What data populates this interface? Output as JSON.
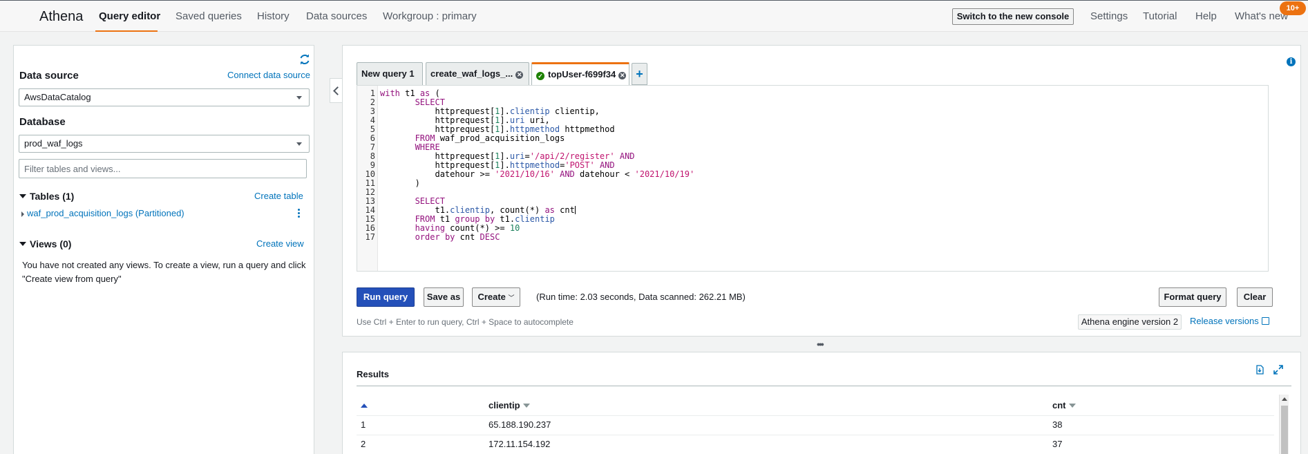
{
  "nav": {
    "brand": "Athena",
    "items": [
      {
        "label": "Query editor",
        "active": true
      },
      {
        "label": "Saved queries"
      },
      {
        "label": "History"
      },
      {
        "label": "Data sources"
      },
      {
        "label": "Workgroup : primary"
      }
    ],
    "switch_console": "Switch to the new console",
    "right_items": [
      "Settings",
      "Tutorial",
      "Help",
      "What's new"
    ],
    "badge": "10+"
  },
  "sidebar": {
    "data_source_label": "Data source",
    "connect_link": "Connect data source",
    "data_source_value": "AwsDataCatalog",
    "database_label": "Database",
    "database_value": "prod_waf_logs",
    "filter_placeholder": "Filter tables and views...",
    "tables_heading": "Tables (1)",
    "create_table": "Create table",
    "table_item": "waf_prod_acquisition_logs (Partitioned)",
    "views_heading": "Views (0)",
    "create_view": "Create view",
    "views_message": "You have not created any views. To create a view, run a query and click \"Create view from query\""
  },
  "editor": {
    "tabs": [
      "New query 1",
      "create_waf_logs_...",
      "topUser-f699f34"
    ],
    "add_tab": "+",
    "line_numbers": [
      "1",
      "2",
      "3",
      "4",
      "5",
      "6",
      "7",
      "8",
      "9",
      "10",
      "11",
      "12",
      "13",
      "14",
      "15",
      "16",
      "17"
    ],
    "run_query": "Run query",
    "save_as": "Save as",
    "create": "Create",
    "run_info": "(Run time: 2.03 seconds, Data scanned: 262.21 MB)",
    "format_query": "Format query",
    "clear": "Clear",
    "hint": "Use Ctrl + Enter to run query, Ctrl + Space to autocomplete",
    "engine": "Athena engine version 2",
    "release_versions": "Release versions"
  },
  "results": {
    "title": "Results",
    "columns": [
      "clientip",
      "cnt"
    ],
    "rows": [
      {
        "index": "1",
        "clientip": "65.188.190.237",
        "cnt": "38"
      },
      {
        "index": "2",
        "clientip": "172.11.154.192",
        "cnt": "37"
      }
    ]
  }
}
